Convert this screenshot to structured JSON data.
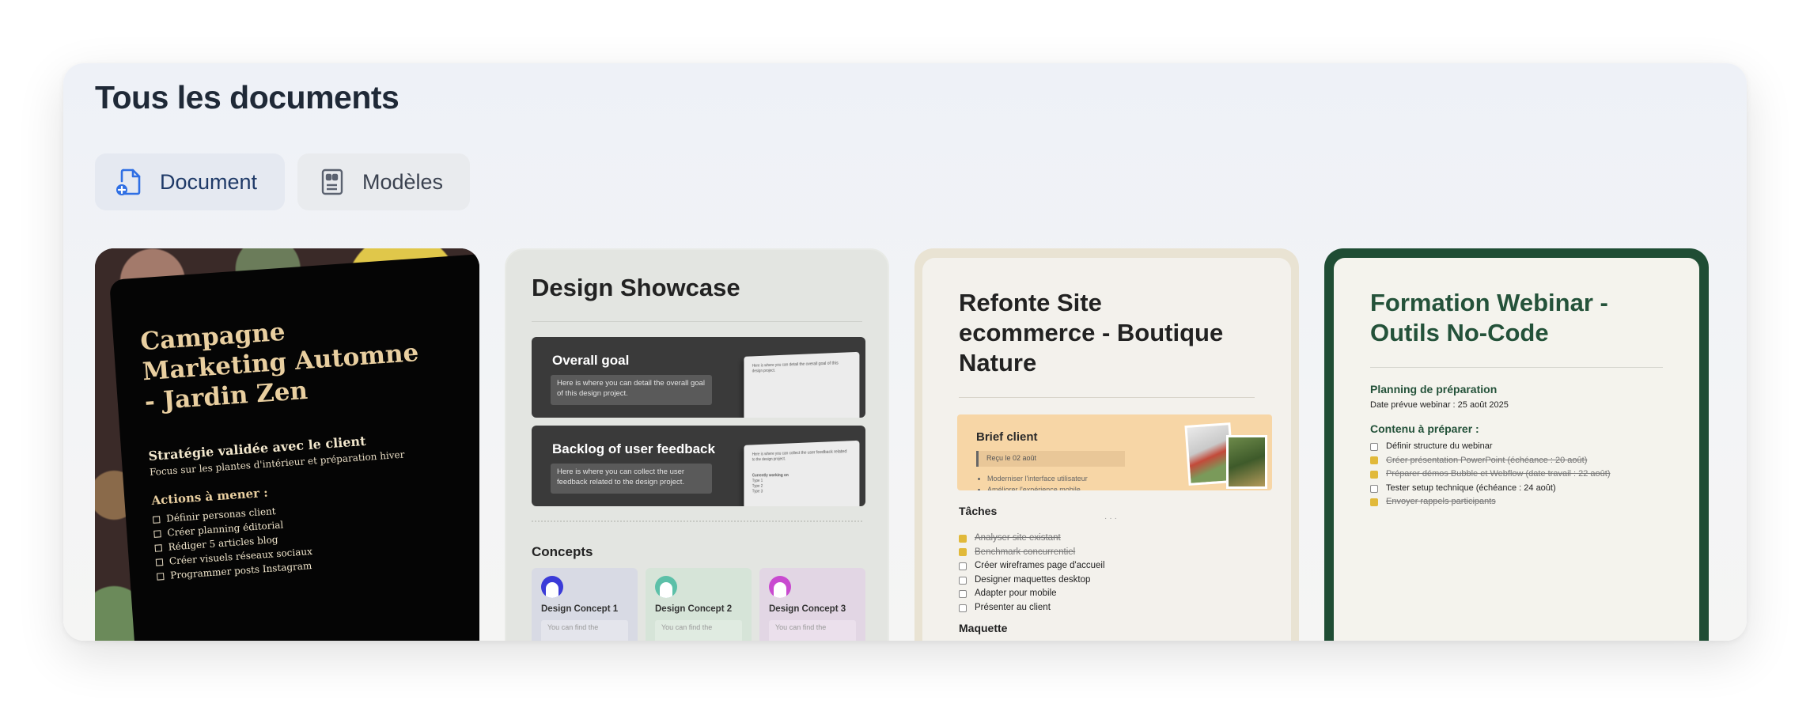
{
  "header": {
    "title": "Tous les documents"
  },
  "tabs": [
    {
      "label": "Document",
      "icon": "file-plus-icon",
      "active": true
    },
    {
      "label": "Modèles",
      "icon": "template-icon",
      "active": false
    }
  ],
  "cards": [
    {
      "title": "Campagne Marketing Automne - Jardin Zen",
      "heading": "Stratégie validée avec le client",
      "subheading": "Focus sur les plantes d'intérieur et préparation hiver",
      "actions_title": "Actions à mener :",
      "actions": [
        "Définir personas client",
        "Créer planning éditorial",
        "Rédiger 5 articles blog",
        "Créer visuels réseaux sociaux",
        "Programmer posts Instagram"
      ]
    },
    {
      "title": "Design Showcase",
      "blocks": [
        {
          "heading": "Overall goal",
          "desc": "Here is where you can detail the overall goal of this design project.",
          "shot_text": "Here is where you can detail the overall goal of this design project."
        },
        {
          "heading": "Backlog of user feedback",
          "desc": "Here is where you can collect the user feedback related to the design project.",
          "shot_text": "Here is where you can collect the user feedback related to the design project.",
          "shot_sub": "Currently working on",
          "shot_items": [
            "Type 1",
            "Type 2",
            "Type 3"
          ]
        }
      ],
      "concepts_title": "Concepts",
      "concepts": [
        {
          "name": "Design Concept 1",
          "text": "You can find the",
          "color": "#3b3bd8",
          "bg": "#d8dae4",
          "snip_bg": "#e4e5ec"
        },
        {
          "name": "Design Concept 2",
          "text": "You can find the",
          "color": "#5cc0a8",
          "bg": "#d6e4d8",
          "snip_bg": "#e0ebe1"
        },
        {
          "name": "Design Concept 3",
          "text": "You can find the",
          "color": "#c94ad0",
          "bg": "#e2d6e4",
          "snip_bg": "#ebe0ec"
        }
      ]
    },
    {
      "title": "Refonte Site ecommerce - Boutique Nature",
      "brief_title": "Brief client",
      "brief_quote": "Reçu le 02 août",
      "brief_items": [
        "Moderniser l'interface utilisateur",
        "Améliorer l'expérience mobile"
      ],
      "tasks_title": "Tâches",
      "tasks": [
        {
          "label": "Analyser site existant",
          "done": true
        },
        {
          "label": "Benchmark concurrentiel",
          "done": true
        },
        {
          "label": "Créer wireframes page d'accueil",
          "done": false
        },
        {
          "label": "Designer maquettes desktop",
          "done": false
        },
        {
          "label": "Adapter pour mobile",
          "done": false
        },
        {
          "label": "Présenter au client",
          "done": false
        }
      ],
      "maquette_title": "Maquette"
    },
    {
      "title": "Formation Webinar - Outils No-Code",
      "section1": "Planning de préparation",
      "date": "Date prévue webinar : 25 août 2025",
      "section2": "Contenu à préparer :",
      "items": [
        {
          "label": "Définir structure du webinar",
          "done": false
        },
        {
          "label": "Créer présentation PowerPoint (échéance : 20 août)",
          "done": true
        },
        {
          "label": "Préparer démos Bubble et Webflow (date travail : 22 août)",
          "done": true
        },
        {
          "label": "Tester setup technique (échéance : 24 août)",
          "done": false
        },
        {
          "label": "Envoyer rappels participants",
          "done": true
        }
      ]
    }
  ]
}
